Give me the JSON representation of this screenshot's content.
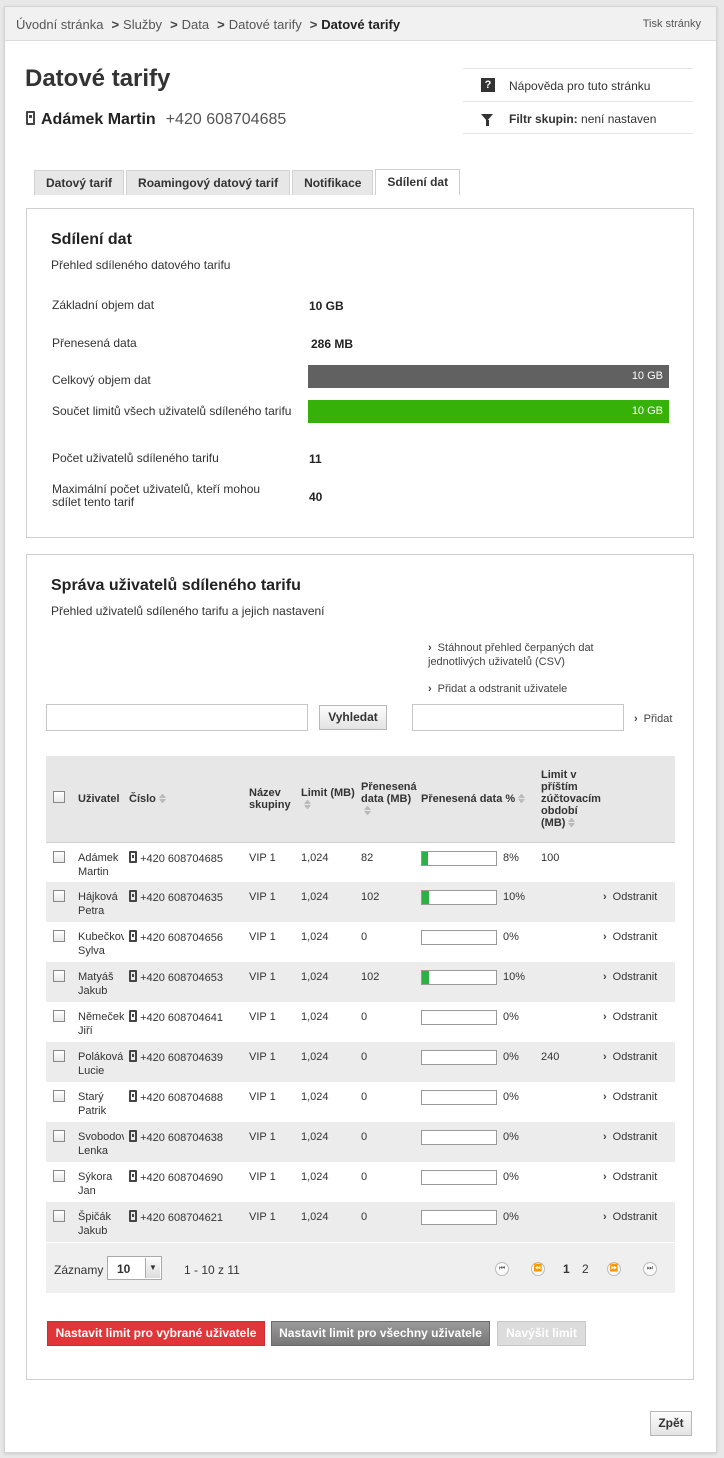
{
  "breadcrumb": {
    "items": [
      "Úvodní stránka",
      "Služby",
      "Data",
      "Datové tarify"
    ],
    "current": "Datové tarify",
    "separator": ">"
  },
  "print_label": "Tisk stránky",
  "page_title": "Datové tarify",
  "user": {
    "name": "Adámek Martin",
    "phone": "+420 608704685"
  },
  "help": {
    "help_label": "Nápověda pro tuto stránku",
    "filter_label": "Filtr skupin:",
    "filter_value": "není nastaven"
  },
  "tabs": [
    {
      "label": "Datový tarif",
      "active": false
    },
    {
      "label": "Roamingový datový tarif",
      "active": false
    },
    {
      "label": "Notifikace",
      "active": false
    },
    {
      "label": "Sdílení dat",
      "active": true
    }
  ],
  "sharing": {
    "title": "Sdílení dat",
    "subtitle": "Přehled sdíleného datového tarifu",
    "rows": [
      {
        "label": "Základní objem dat",
        "value": "10 GB"
      },
      {
        "label": "Přenesená data",
        "value": "286 MB"
      },
      {
        "label": "Celkový objem dat",
        "value": "10 GB"
      },
      {
        "label": "Součet limitů všech uživatelů sdíleného tarifu",
        "value": "10 GB"
      },
      {
        "label": "Počet uživatelů sdíleného tarifu",
        "value": "11"
      },
      {
        "label": "Maximální počet uživatelů, kteří mohou sdílet tento tarif",
        "value": "40"
      }
    ],
    "total_bar_color": "#616161",
    "limit_bar_color": "#36b10a"
  },
  "manage": {
    "title": "Správa uživatelů sdíleného tarifu",
    "subtitle": "Přehled uživatelů sdíleného tarifu a jejich nastavení",
    "link_download": "Stáhnout přehled čerpaných dat jednotlivých uživatelů (CSV)",
    "link_add_remove": "Přidat a odstranit uživatele",
    "search_button": "Vyhledat",
    "add_link": "Přidat"
  },
  "table": {
    "columns": {
      "user": "Uživatel",
      "number": "Číslo",
      "group": "Název skupiny",
      "limit": "Limit (MB)",
      "transferred": "Přenesená data (MB)",
      "transferred_pct": "Přenesená data %",
      "next_limit": "Limit v příštím zúčtovacím období (MB)"
    },
    "rows": [
      {
        "name": "Adámek Martin",
        "phone": "+420 608704685",
        "group": "VIP 1",
        "limit": "1,024",
        "data": "82",
        "pct": 8,
        "pct_label": "8%",
        "next": "100",
        "action": ""
      },
      {
        "name": "Hájková Petra",
        "phone": "+420 608704635",
        "group": "VIP 1",
        "limit": "1,024",
        "data": "102",
        "pct": 10,
        "pct_label": "10%",
        "next": "",
        "action": "Odstranit"
      },
      {
        "name": "Kubečková Sylva",
        "phone": "+420 608704656",
        "group": "VIP 1",
        "limit": "1,024",
        "data": "0",
        "pct": 0,
        "pct_label": "0%",
        "next": "",
        "action": "Odstranit"
      },
      {
        "name": "Matyáš Jakub",
        "phone": "+420 608704653",
        "group": "VIP 1",
        "limit": "1,024",
        "data": "102",
        "pct": 10,
        "pct_label": "10%",
        "next": "",
        "action": "Odstranit"
      },
      {
        "name": "Němeček Jiří",
        "phone": "+420 608704641",
        "group": "VIP 1",
        "limit": "1,024",
        "data": "0",
        "pct": 0,
        "pct_label": "0%",
        "next": "",
        "action": "Odstranit"
      },
      {
        "name": "Poláková Lucie",
        "phone": "+420 608704639",
        "group": "VIP 1",
        "limit": "1,024",
        "data": "0",
        "pct": 0,
        "pct_label": "0%",
        "next": "240",
        "action": "Odstranit"
      },
      {
        "name": "Starý Patrik",
        "phone": "+420 608704688",
        "group": "VIP 1",
        "limit": "1,024",
        "data": "0",
        "pct": 0,
        "pct_label": "0%",
        "next": "",
        "action": "Odstranit"
      },
      {
        "name": "Svobodová Lenka",
        "phone": "+420 608704638",
        "group": "VIP 1",
        "limit": "1,024",
        "data": "0",
        "pct": 0,
        "pct_label": "0%",
        "next": "",
        "action": "Odstranit"
      },
      {
        "name": "Sýkora Jan",
        "phone": "+420 608704690",
        "group": "VIP 1",
        "limit": "1,024",
        "data": "0",
        "pct": 0,
        "pct_label": "0%",
        "next": "",
        "action": "Odstranit"
      },
      {
        "name": "Špičák Jakub",
        "phone": "+420 608704621",
        "group": "VIP 1",
        "limit": "1,024",
        "data": "0",
        "pct": 0,
        "pct_label": "0%",
        "next": "",
        "action": "Odstranit"
      }
    ]
  },
  "pager": {
    "records_label": "Záznamy",
    "page_size": "10",
    "range": "1 - 10 z 11",
    "pages": [
      "1",
      "2"
    ],
    "current_page": "1"
  },
  "actions": {
    "set_selected": "Nastavit limit pro vybrané uživatele",
    "set_all": "Nastavit limit pro všechny uživatele",
    "raise": "Navýšit limit",
    "set_selected_color": "#e0363a"
  },
  "back_label": "Zpět",
  "progress_fill_color": "#2db146"
}
